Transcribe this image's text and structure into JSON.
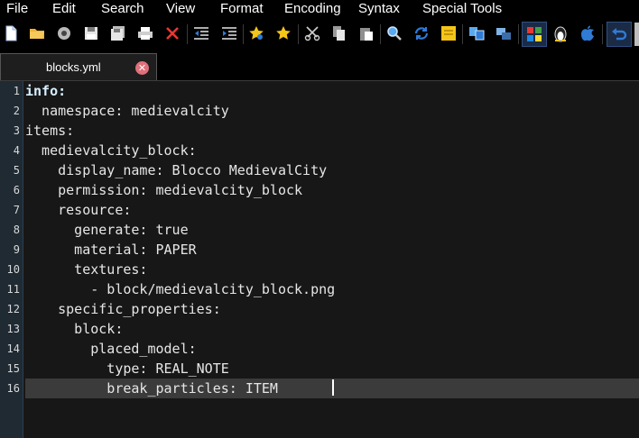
{
  "menu": {
    "file": "File",
    "edit": "Edit",
    "search": "Search",
    "view": "View",
    "format": "Format",
    "encoding": "Encoding",
    "syntax": "Syntax",
    "special_tools": "Special Tools"
  },
  "toolbar": {
    "icons": [
      "new-file-icon",
      "open-folder-icon",
      "reload-icon",
      "save-icon",
      "save-all-icon",
      "print-icon",
      "close-icon",
      "unindent-icon",
      "indent-icon",
      "bookmark-icon",
      "next-bookmark-icon",
      "cut-icon",
      "copy-icon",
      "paste-icon",
      "find-icon",
      "replace-icon",
      "sticky-note-icon",
      "compare-icon",
      "window-icon",
      "windows-icon",
      "linux-icon",
      "apple-icon",
      "undo-icon"
    ],
    "colors": {
      "accent": "#f5c518",
      "close": "#e53935",
      "blue": "#2f7bd6"
    }
  },
  "tabs": [
    {
      "label": "blocks.yml",
      "active": true
    }
  ],
  "editor": {
    "line_numbers": [
      "1",
      "2",
      "3",
      "4",
      "5",
      "6",
      "7",
      "8",
      "9",
      "10",
      "11",
      "12",
      "13",
      "14",
      "15",
      "16"
    ],
    "lines": [
      "info:",
      "  namespace: medievalcity",
      "items:",
      "  medievalcity_block:",
      "    display_name: Blocco MedievalCity",
      "    permission: medievalcity_block",
      "    resource:",
      "      generate: true",
      "      material: PAPER",
      "      textures:",
      "        - block/medievalcity_block.png",
      "    specific_properties:",
      "      block:",
      "        placed_model:",
      "          type: REAL_NOTE",
      "          break_particles: ITEM"
    ],
    "current_line": "16"
  }
}
